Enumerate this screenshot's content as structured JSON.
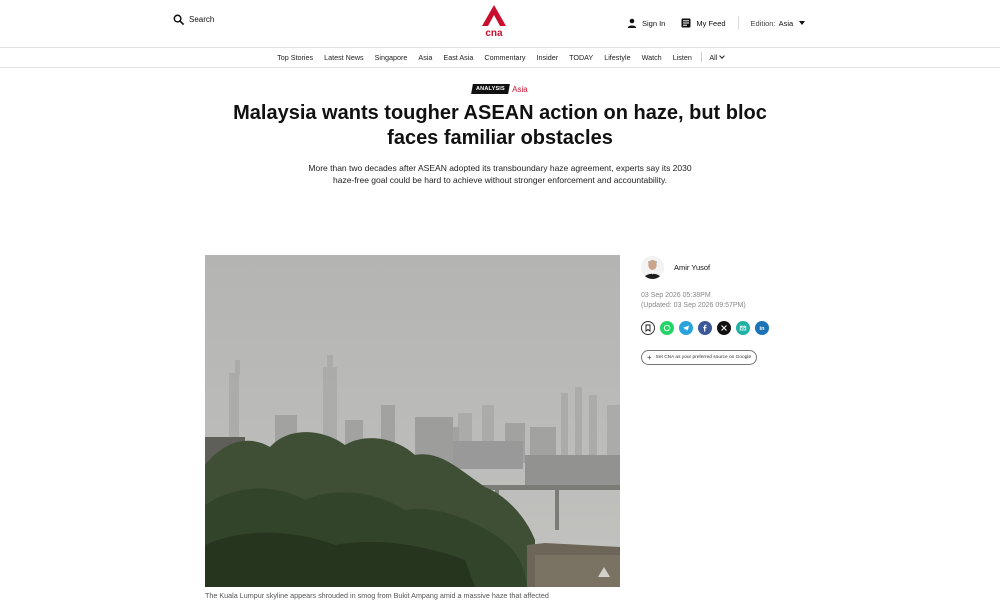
{
  "header": {
    "search_label": "Search",
    "signin_label": "Sign In",
    "myfeed_label": "My Feed",
    "edition_label": "Edition:",
    "edition_value": "Asia",
    "logo_text": "cna",
    "brand_color": "#c8102e"
  },
  "nav": {
    "items": [
      "Top Stories",
      "Latest News",
      "Singapore",
      "Asia",
      "East Asia",
      "Commentary",
      "Insider",
      "TODAY",
      "Lifestyle",
      "Watch",
      "Listen"
    ],
    "all_label": "All"
  },
  "article": {
    "badge": "ANALYSIS",
    "category": "Asia",
    "headline": "Malaysia wants tougher ASEAN action on haze, but bloc faces familiar obstacles",
    "standfirst": "More than two decades after ASEAN adopted its transboundary haze agreement, experts say its 2030 haze-free goal could be hard to achieve without stronger enforcement and accountability.",
    "caption": "The Kuala Lumpur skyline appears shrouded in smog from Bukit Ampang amid a massive haze that affected"
  },
  "sidebar": {
    "author": "Amir Yusof",
    "published": "03 Sep 2026 05:38PM",
    "updated": "(Updated: 03 Sep 2026 09:57PM)",
    "share_icons": [
      {
        "name": "bookmark-icon",
        "color": "#ffffff"
      },
      {
        "name": "whatsapp-icon",
        "color": "#25d366"
      },
      {
        "name": "telegram-icon",
        "color": "#2aa3dc"
      },
      {
        "name": "facebook-icon",
        "color": "#3b5998"
      },
      {
        "name": "x-icon",
        "color": "#111111"
      },
      {
        "name": "email-icon",
        "color": "#21b0a4"
      },
      {
        "name": "linkedin-icon",
        "color": "#1b74b8"
      }
    ],
    "google_source_label": "Set CNA as your preferred source on Google"
  }
}
